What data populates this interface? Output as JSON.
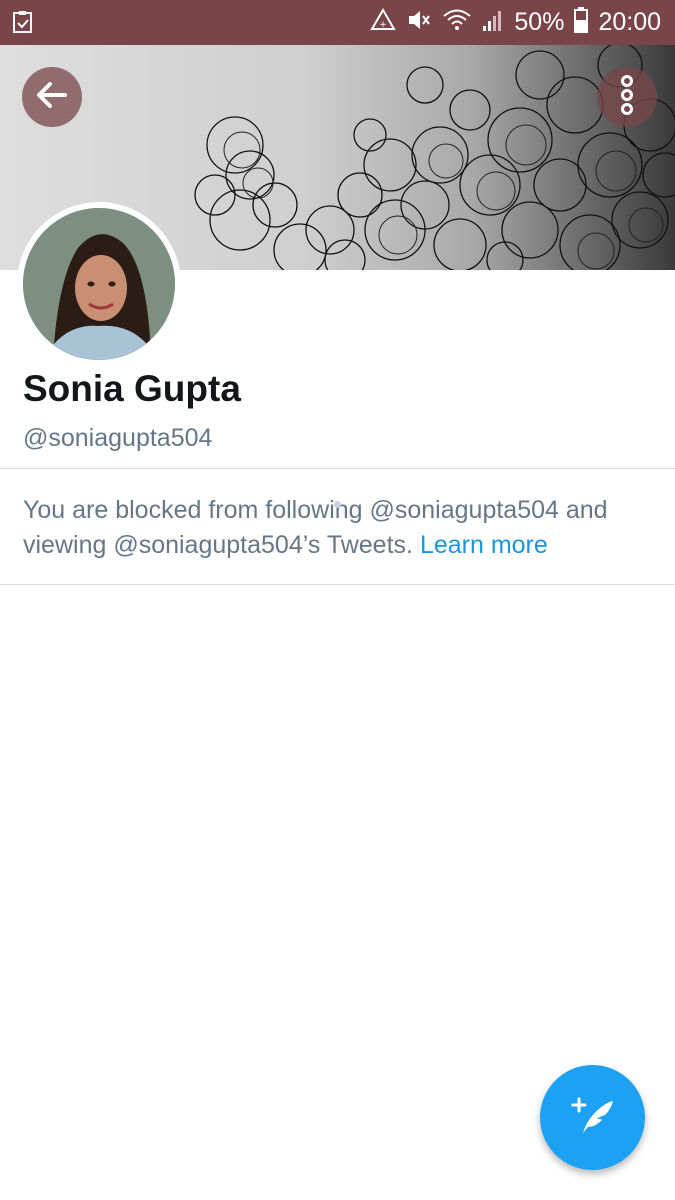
{
  "status_bar": {
    "battery": "50%",
    "time": "20:00",
    "icons": [
      "task-icon",
      "data-saver-icon",
      "mute-icon",
      "wifi-icon",
      "signal-icon",
      "battery-icon"
    ]
  },
  "header": {
    "back_icon": "arrow-left-icon",
    "more_icon": "more-vertical-icon"
  },
  "profile": {
    "name": "Sonia Gupta",
    "handle": "@soniagupta504"
  },
  "blocked": {
    "message": "You are blocked from following @soniagupta504 and viewing @soniagupta504’s Tweets.",
    "link": "Learn more"
  },
  "colors": {
    "status_bar": "#7a4548",
    "accent": "#1da1f2",
    "link": "#1b95e0",
    "secondary_text": "#657786"
  }
}
